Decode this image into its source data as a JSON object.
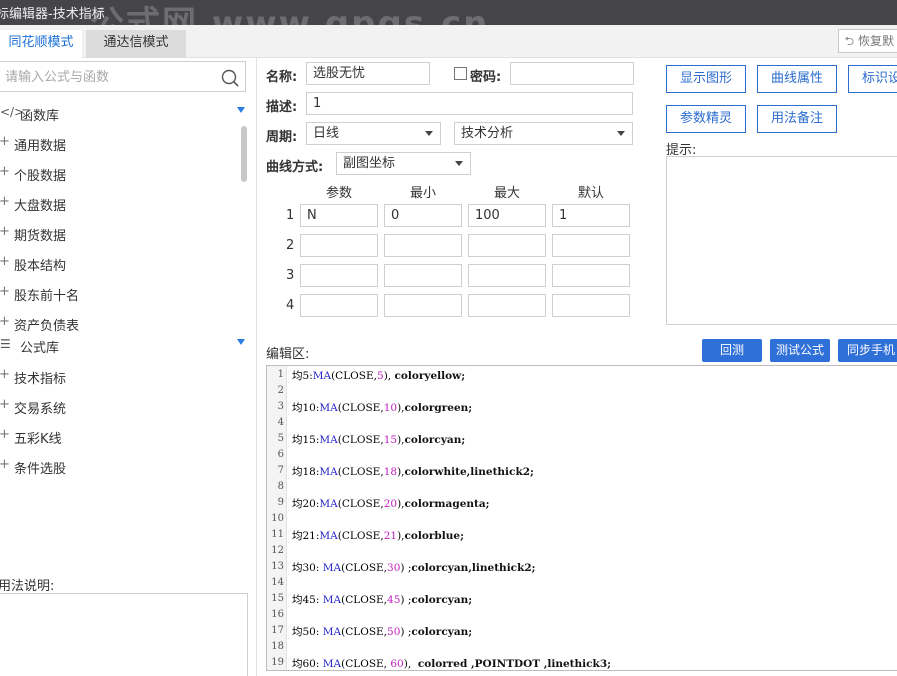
{
  "window": {
    "title": "标编辑器-技术指标",
    "watermark": "公式网 www.gpgs.cn"
  },
  "tabs": {
    "active": "同花顺模式",
    "inactive": "通达信模式",
    "restore": "恢复默"
  },
  "left_panel": {
    "search_placeholder": "请输入公式与函数",
    "groups": [
      {
        "label": "函数库",
        "items": [
          "通用数据",
          "个股数据",
          "大盘数据",
          "期货数据",
          "股本结构",
          "股东前十名",
          "资产负债表"
        ]
      },
      {
        "label": "公式库",
        "items": [
          "技术指标",
          "交易系统",
          "五彩K线",
          "条件选股"
        ]
      }
    ],
    "usage_label": "用法说明:"
  },
  "form": {
    "name_label": "名称:",
    "name_value": "选股无忧",
    "password_label": "密码:",
    "password_value": "",
    "desc_label": "描述:",
    "desc_value": "1",
    "period_label": "周期:",
    "period_value": "日线",
    "category_value": "技术分析",
    "curve_label": "曲线方式:",
    "curve_value": "副图坐标"
  },
  "params": {
    "headers": [
      "参数",
      "最小",
      "最大",
      "默认"
    ],
    "rows": [
      {
        "num": "1",
        "cells": [
          "N",
          "0",
          "100",
          "1"
        ]
      },
      {
        "num": "2",
        "cells": [
          "",
          "",
          "",
          ""
        ]
      },
      {
        "num": "3",
        "cells": [
          "",
          "",
          "",
          ""
        ]
      },
      {
        "num": "4",
        "cells": [
          "",
          "",
          "",
          ""
        ]
      }
    ]
  },
  "right_buttons": {
    "show_chart": "显示图形",
    "curve_props": "曲线属性",
    "mark_settings": "标识设",
    "param_wizard": "参数精灵",
    "usage_note": "用法备注"
  },
  "hint_label": "提示:",
  "editor": {
    "label": "编辑区:",
    "buttons": {
      "backtest": "回测",
      "test_formula": "测试公式",
      "sync_phone": "同步手机"
    },
    "lines": [
      {
        "n": "1",
        "name": "均5",
        "sep": ":",
        "arg": "5",
        "tail": ", ",
        "kw": "coloryellow;"
      },
      {
        "n": "2"
      },
      {
        "n": "3",
        "name": "均10",
        "sep": ":",
        "arg": "10",
        "tail": ",",
        "kw": "colorgreen;"
      },
      {
        "n": "4"
      },
      {
        "n": "5",
        "name": "均15",
        "sep": ":",
        "arg": "15",
        "tail": ",",
        "kw": "colorcyan;"
      },
      {
        "n": "6"
      },
      {
        "n": "7",
        "name": "均18",
        "sep": ":",
        "arg": "18",
        "tail": ",",
        "kw": "colorwhite,linethick2;"
      },
      {
        "n": "8"
      },
      {
        "n": "9",
        "name": "均20",
        "sep": ":",
        "arg": "20",
        "tail": ",",
        "kw": "colormagenta;"
      },
      {
        "n": "10"
      },
      {
        "n": "11",
        "name": "均21",
        "sep": ":",
        "arg": "21",
        "tail": ",",
        "kw": "colorblue;"
      },
      {
        "n": "12"
      },
      {
        "n": "13",
        "name": "均30",
        "sep": ": ",
        "arg": "30",
        "tail": " ;",
        "kw": "colorcyan,linethick2;"
      },
      {
        "n": "14"
      },
      {
        "n": "15",
        "name": "均45",
        "sep": ": ",
        "arg": "45",
        "tail": " ;",
        "kw": "colorcyan;"
      },
      {
        "n": "16"
      },
      {
        "n": "17",
        "name": "均50",
        "sep": ": ",
        "arg": "50",
        "tail": " ;",
        "kw": "colorcyan;"
      },
      {
        "n": "18"
      },
      {
        "n": "19",
        "name": "均60",
        "sep": ": ",
        "arg": " 60",
        "tail": ",  ",
        "kw": "colorred ,POINTDOT ,linethick3;"
      }
    ]
  },
  "colors": {
    "accent": "#2b6ccd",
    "titlebar": "#454549",
    "button_blue": "#2f6fd8"
  }
}
